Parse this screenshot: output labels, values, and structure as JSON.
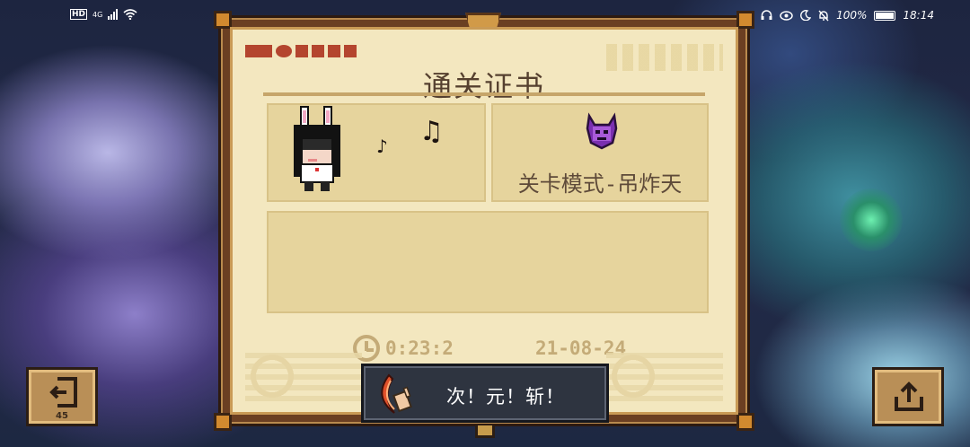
{
  "status_bar": {
    "network": "HD",
    "cellular": "4G",
    "battery": "100%",
    "time": "18:14",
    "icons": [
      "headset-icon",
      "eye-icon",
      "moon-icon",
      "mute-icon",
      "battery-icon"
    ]
  },
  "certificate": {
    "title": "通关证书",
    "mode": "关卡模式-吊炸天",
    "character_icon": "bunny-ear-girl-icon",
    "boss_icon": "purple-demon-icon",
    "notes": [
      "♪",
      "♫"
    ],
    "time": "0:23:2",
    "date": "21-08-24"
  },
  "weapon": {
    "name": "次！元！斩！",
    "icon": "crescent-blade-icon"
  },
  "buttons": {
    "exit_label": "45",
    "exit_icon": "exit-door-icon",
    "share_icon": "share-upload-icon"
  },
  "colors": {
    "frame": "#6b3f22",
    "paper": "#f3e7bf",
    "panel": "#e6d49d",
    "text": "#5e4a39",
    "stat": "#c4ab78"
  }
}
